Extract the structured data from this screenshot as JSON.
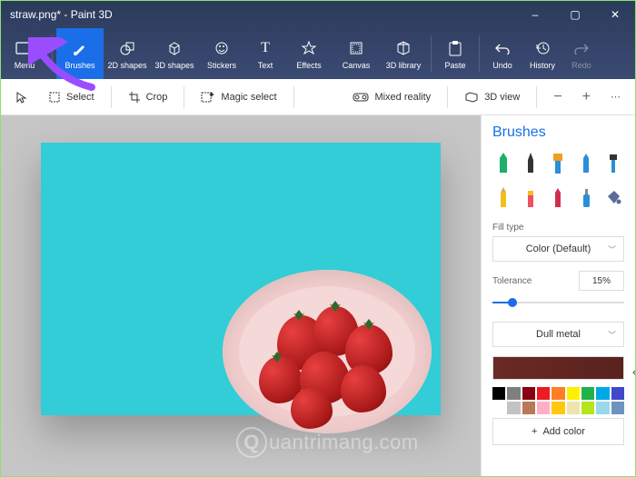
{
  "window": {
    "title": "straw.png* - Paint 3D",
    "controls": {
      "min": "–",
      "max": "▢",
      "close": "✕"
    }
  },
  "ribbon": {
    "menu": "Menu",
    "items": [
      {
        "name": "brushes",
        "label": "Brushes",
        "active": true
      },
      {
        "name": "2d-shapes",
        "label": "2D shapes"
      },
      {
        "name": "3d-shapes",
        "label": "3D shapes"
      },
      {
        "name": "stickers",
        "label": "Stickers"
      },
      {
        "name": "text",
        "label": "Text"
      },
      {
        "name": "effects",
        "label": "Effects"
      },
      {
        "name": "canvas",
        "label": "Canvas"
      },
      {
        "name": "3d-library",
        "label": "3D library"
      }
    ],
    "paste": "Paste",
    "undo": "Undo",
    "history": "History",
    "redo": "Redo"
  },
  "toolbar": {
    "select": "Select",
    "crop": "Crop",
    "magic_select": "Magic select",
    "mixed_reality": "Mixed reality",
    "view3d": "3D view"
  },
  "sidebar": {
    "title": "Brushes",
    "fill_type_label": "Fill type",
    "fill_type_value": "Color (Default)",
    "tolerance_label": "Tolerance",
    "tolerance_value": "15%",
    "material_value": "Dull metal",
    "add_color": "Add color",
    "current_color": "#5a221e",
    "palette_row1": [
      "#000000",
      "#7f7f7f",
      "#870014",
      "#ec1c23",
      "#ff7e26",
      "#fef100",
      "#21b24b",
      "#00a8e8",
      "#3f47cc"
    ],
    "palette_row2": [
      "#ffffff",
      "#c3c3c3",
      "#b97956",
      "#ffaec8",
      "#ffc80d",
      "#efe3ae",
      "#b5e51c",
      "#99d9ea",
      "#7092be"
    ]
  },
  "watermark": "uantrimang.com"
}
